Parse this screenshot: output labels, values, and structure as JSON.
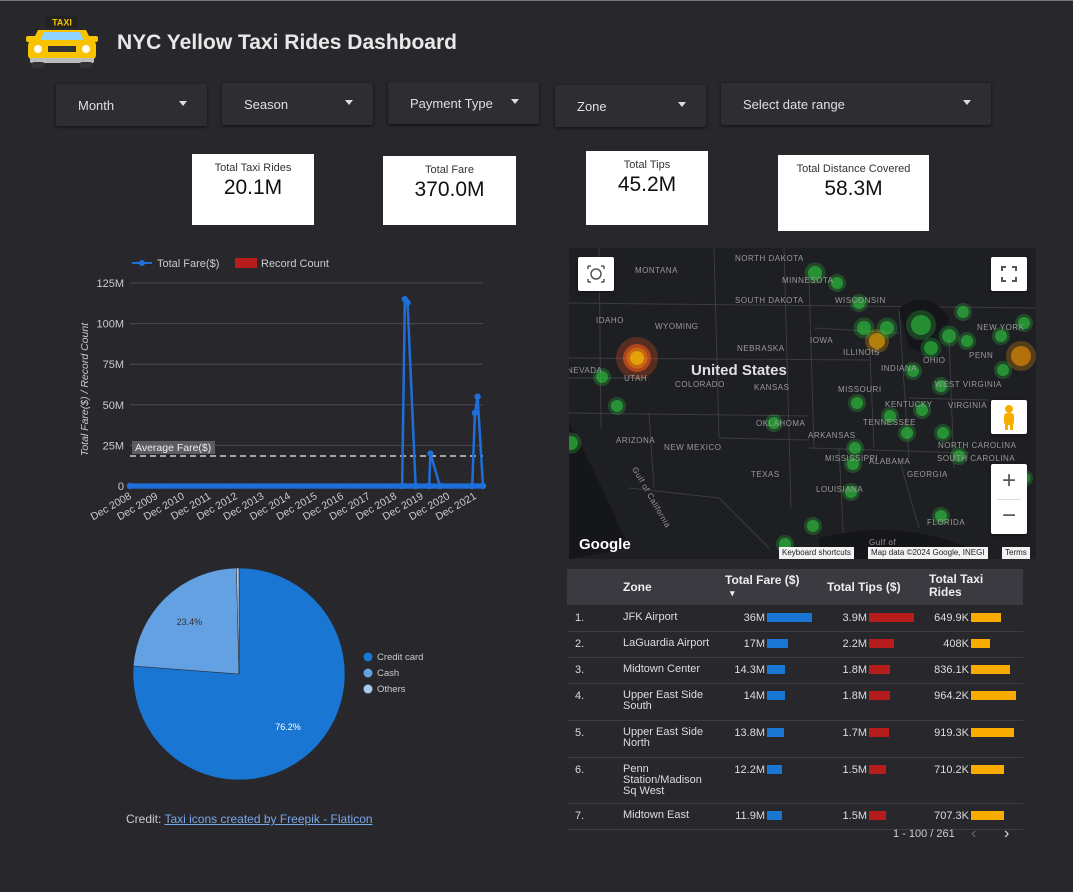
{
  "header": {
    "title": "NYC Yellow Taxi Rides Dashboard",
    "logo_text": "TAXI"
  },
  "filters": [
    "Month",
    "Season",
    "Payment Type",
    "Zone",
    "Select date range"
  ],
  "kpis": [
    {
      "label": "Total Taxi Rides",
      "value": "20.1M"
    },
    {
      "label": "Total Fare",
      "value": "370.0M"
    },
    {
      "label": "Total Tips",
      "value": "45.2M"
    },
    {
      "label": "Total Distance Covered",
      "value": "58.3M"
    }
  ],
  "chart_data": [
    {
      "type": "line",
      "legend": [
        "Total Fare($)",
        "Record Count"
      ],
      "ylabel": "Total Fare($) / Record Count",
      "yticks": [
        "0",
        "25M",
        "50M",
        "75M",
        "100M",
        "125M"
      ],
      "ylim": [
        0,
        125000000
      ],
      "xticks": [
        "Dec 2008",
        "Dec 2009",
        "Dec 2010",
        "Dec 2011",
        "Dec 2012",
        "Dec 2013",
        "Dec 2014",
        "Dec 2015",
        "Dec 2016",
        "Dec 2017",
        "Dec 2018",
        "Dec 2019",
        "Dec 2020",
        "Dec 2021"
      ],
      "reference_line": {
        "label": "Average Fare($)",
        "value": 18500000
      },
      "colors": {
        "fare": "#1e6fd9",
        "count": "#b71c1c",
        "avg": "#cfcfcf"
      },
      "series": [
        {
          "name": "Total Fare($)",
          "x": [
            2008.9,
            2019.0,
            2019.1,
            2019.2,
            2019.5,
            2020.0,
            2020.05,
            2020.4,
            2021.6,
            2021.7,
            2021.8,
            2022.0
          ],
          "values": [
            0,
            0,
            115000000,
            113000000,
            0,
            0,
            20000000,
            0,
            0,
            45000000,
            55000000,
            0
          ]
        }
      ]
    },
    {
      "type": "pie",
      "labels": [
        "Credit card",
        "Cash",
        "Others"
      ],
      "values": [
        76.2,
        23.4,
        0.4
      ],
      "value_labels": [
        "76.2%",
        "23.4%",
        ""
      ],
      "colors": [
        "#1976d2",
        "#64a1e2",
        "#a8c8f0"
      ]
    }
  ],
  "map": {
    "country_label": "United States",
    "state_labels": [
      "NORTH DAKOTA",
      "MONTANA",
      "MINNESOTA",
      "SOUTH DAKOTA",
      "WISCONSIN",
      "IDAHO",
      "WYOMING",
      "NEBRASKA",
      "IOWA",
      "ILLINOIS",
      "OHIO",
      "NEW YORK",
      "PENN",
      "UTAH",
      "COLORADO",
      "KANSAS",
      "MISSOURI",
      "INDIANA",
      "WEST VIRGINIA",
      "KENTUCKY",
      "VIRGINIA",
      "NEVADA",
      "ARIZONA",
      "NEW MEXICO",
      "OKLAHOMA",
      "ARKANSAS",
      "TENNESSEE",
      "NORTH CAROLINA",
      "SOUTH CAROLINA",
      "MISSISSIPPI",
      "ALABAMA",
      "GEORGIA",
      "TEXAS",
      "LOUISIANA",
      "FLORIDA",
      "Gulf of California",
      "Gulf of"
    ],
    "attribution": {
      "logo": "Google",
      "shortcuts": "Keyboard shortcuts",
      "data": "Map data ©2024 Google, INEGI",
      "terms": "Terms"
    },
    "icons": [
      "locate-icon",
      "fullscreen-icon",
      "pegman-icon"
    ],
    "zoom_in": "+",
    "zoom_out": "−"
  },
  "table": {
    "headers": {
      "zone": "Zone",
      "fare": "Total Fare ($)",
      "tips": "Total Tips ($)",
      "rides": "Total Taxi Rides"
    },
    "sort_indicator": "▾",
    "bar_colors": {
      "fare": "#1976d2",
      "tips": "#b71c1c",
      "rides": "#f9ab00"
    },
    "rows": [
      {
        "n": "1.",
        "zone": "JFK Airport",
        "fare": "36M",
        "fare_v": 36,
        "tips": "3.9M",
        "tips_v": 3.9,
        "rides": "649.9K",
        "rides_v": 649.9
      },
      {
        "n": "2.",
        "zone": "LaGuardia Airport",
        "fare": "17M",
        "fare_v": 17,
        "tips": "2.2M",
        "tips_v": 2.2,
        "rides": "408K",
        "rides_v": 408
      },
      {
        "n": "3.",
        "zone": "Midtown Center",
        "fare": "14.3M",
        "fare_v": 14.3,
        "tips": "1.8M",
        "tips_v": 1.8,
        "rides": "836.1K",
        "rides_v": 836.1
      },
      {
        "n": "4.",
        "zone": "Upper East Side South",
        "fare": "14M",
        "fare_v": 14,
        "tips": "1.8M",
        "tips_v": 1.8,
        "rides": "964.2K",
        "rides_v": 964.2
      },
      {
        "n": "5.",
        "zone": "Upper East Side North",
        "fare": "13.8M",
        "fare_v": 13.8,
        "tips": "1.7M",
        "tips_v": 1.7,
        "rides": "919.3K",
        "rides_v": 919.3
      },
      {
        "n": "6.",
        "zone": "Penn Station/Madison Sq West",
        "fare": "12.2M",
        "fare_v": 12.2,
        "tips": "1.5M",
        "tips_v": 1.5,
        "rides": "710.2K",
        "rides_v": 710.2
      },
      {
        "n": "7.",
        "zone": "Midtown East",
        "fare": "11.9M",
        "fare_v": 11.9,
        "tips": "1.5M",
        "tips_v": 1.5,
        "rides": "707.3K",
        "rides_v": 707.3
      }
    ],
    "pagination": "1 - 100 / 261"
  },
  "credit": {
    "prefix": "Credit:",
    "link_text": "Taxi icons created by Freepik - Flaticon"
  }
}
